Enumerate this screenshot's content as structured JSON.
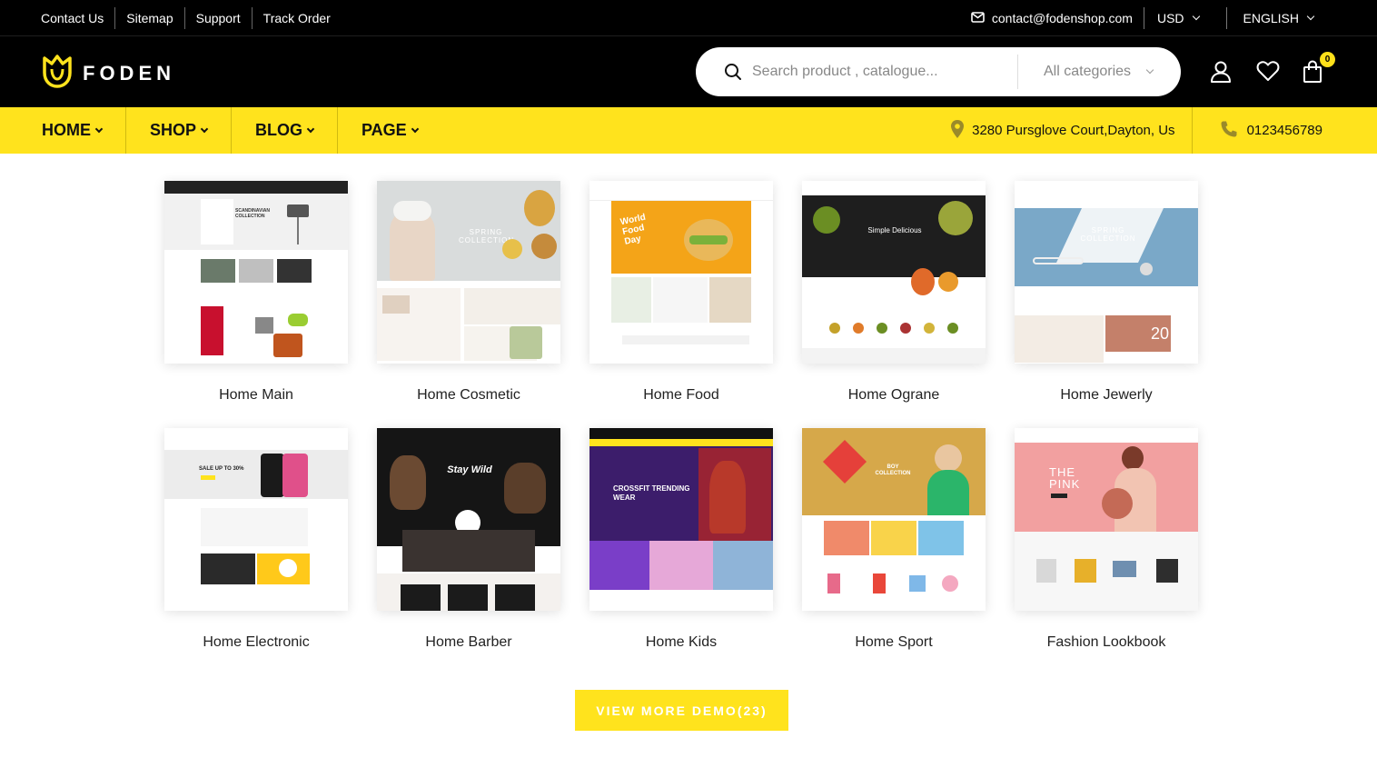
{
  "topbar": {
    "links": [
      "Contact Us",
      "Sitemap",
      "Support",
      "Track Order"
    ],
    "email": "contact@fodenshop.com",
    "currency": "USD",
    "language": "ENGLISH"
  },
  "header": {
    "logo_text": "FODEN",
    "search_placeholder": "Search product , catalogue...",
    "category_select": "All categories",
    "cart_count": "0"
  },
  "nav": {
    "items": [
      "HOME",
      "SHOP",
      "BLOG",
      "PAGE"
    ],
    "address": "3280 Pursglove Court,Dayton, Us",
    "phone": "0123456789"
  },
  "demos": [
    {
      "label": "Home Main",
      "thumb_text": "SCANDINAVIAN COLLECTION"
    },
    {
      "label": "Home Cosmetic",
      "thumb_text": "SPRING COLLECTION"
    },
    {
      "label": "Home Food",
      "thumb_text": "World Food Day"
    },
    {
      "label": "Home Ograne",
      "thumb_text": "Simple Delicious"
    },
    {
      "label": "Home Jewerly",
      "thumb_text": "SPRING COLLECTION"
    },
    {
      "label": "Home Electronic",
      "thumb_text": "SALE UP TO 30%"
    },
    {
      "label": "Home Barber",
      "thumb_text": "Stay Wild"
    },
    {
      "label": "Home Kids",
      "thumb_text": "CROSSFIT TRENDING WEAR"
    },
    {
      "label": "Home Sport",
      "thumb_text": "BOY COLLECTION"
    },
    {
      "label": "Fashion Lookbook",
      "thumb_text": "THE PINK"
    }
  ],
  "view_more_label": "VIEW MORE DEMO(23)",
  "colors": {
    "accent": "#ffe31d",
    "dark": "#000000"
  }
}
